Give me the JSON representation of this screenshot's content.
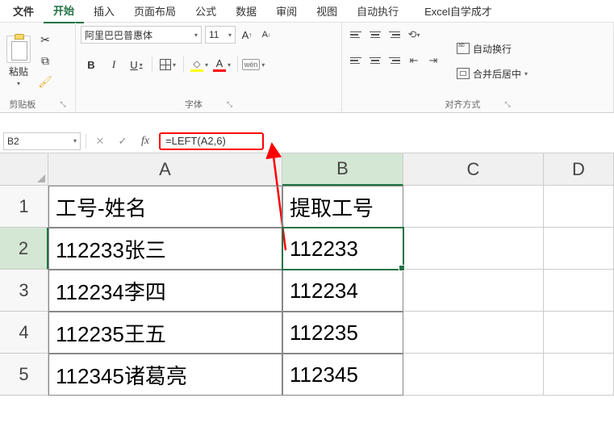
{
  "menu": {
    "file": "文件",
    "home": "开始",
    "insert": "插入",
    "page_layout": "页面布局",
    "formulas": "公式",
    "data": "数据",
    "review": "审阅",
    "view": "视图",
    "auto_exec": "自动执行",
    "excel_title": "Excel自学成才"
  },
  "ribbon": {
    "clipboard": {
      "paste": "粘贴",
      "label": "剪贴板"
    },
    "font": {
      "name": "阿里巴巴普惠体",
      "size": "11",
      "grow": "A↑",
      "shrink": "A↓",
      "bold": "B",
      "italic": "I",
      "underline": "U",
      "wen": "wén",
      "label": "字体"
    },
    "alignment": {
      "wrap": "自动换行",
      "merge": "合并后居中",
      "label": "对齐方式"
    }
  },
  "formula_bar": {
    "cell_ref": "B2",
    "fx": "fx",
    "formula": "=LEFT(A2,6)"
  },
  "columns": [
    "A",
    "B",
    "C",
    "D"
  ],
  "rows": [
    "1",
    "2",
    "3",
    "4",
    "5"
  ],
  "cells": {
    "A1": "工号-姓名",
    "B1": "提取工号",
    "A2": "112233张三",
    "B2": "112233",
    "A3": "112234李四",
    "B3": "112234",
    "A4": "112235王五",
    "B4": "112235",
    "A5": "112345诸葛亮",
    "B5": "112345"
  },
  "selected_cell": "B2"
}
